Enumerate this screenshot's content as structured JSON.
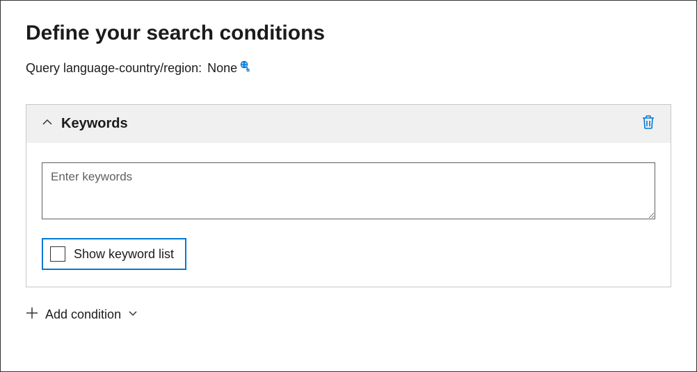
{
  "header": {
    "title": "Define your search conditions",
    "query_lang_label": "Query language-country/region:",
    "query_lang_value": "None"
  },
  "keywords_panel": {
    "title": "Keywords",
    "input_placeholder": "Enter keywords",
    "input_value": "",
    "show_list_label": "Show keyword list",
    "show_list_checked": false
  },
  "add_condition": {
    "label": "Add condition"
  }
}
